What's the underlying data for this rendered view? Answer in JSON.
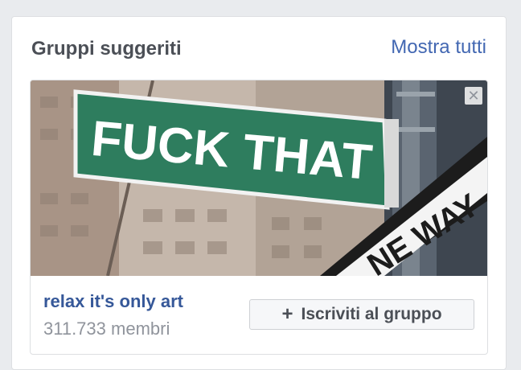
{
  "suggested_groups": {
    "title": "Gruppi suggeriti",
    "see_all_label": "Mostra tutti",
    "card": {
      "image": {
        "sign_text": "FUCK THAT",
        "secondary_sign_text": "NE WAY",
        "close_icon": "close-icon"
      },
      "group_name": "relax it's only art",
      "members": "311.733 membri",
      "join_icon": "plus-icon",
      "join_label": "Iscriviti al gruppo"
    }
  }
}
